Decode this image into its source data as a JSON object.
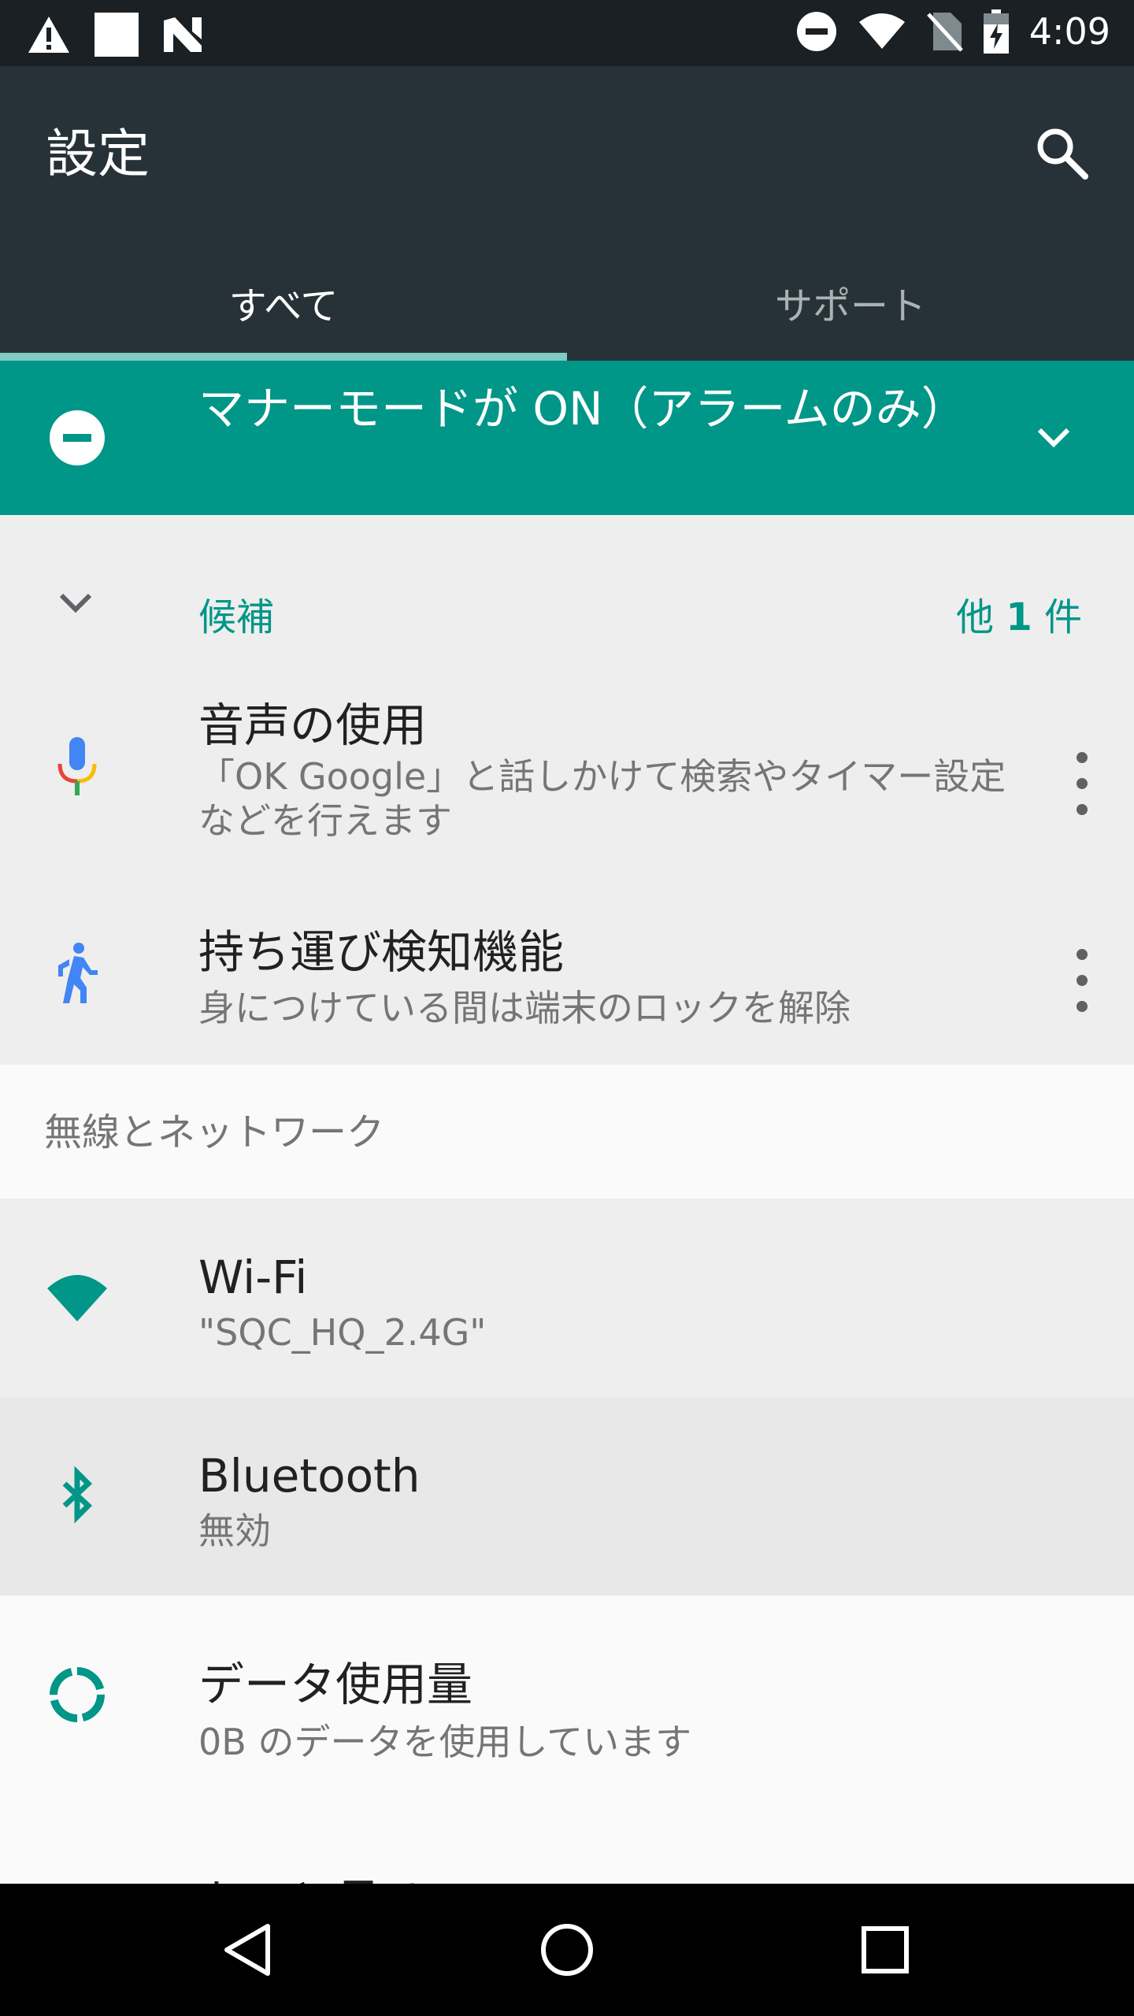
{
  "status_bar": {
    "time": "4:09",
    "left_icons": [
      "warning-icon",
      "square-icon",
      "n-logo-icon"
    ],
    "right_icons": [
      "do-not-disturb-icon",
      "wifi-icon",
      "no-sim-icon",
      "battery-charging-icon"
    ]
  },
  "app_bar": {
    "title": "設定",
    "search_icon": "search-icon",
    "tabs": [
      {
        "label": "すべて",
        "active": true
      },
      {
        "label": "サポート",
        "active": false
      }
    ],
    "indicator_color": "#80cbc4",
    "bg_color": "#263238"
  },
  "dnd_banner": {
    "text": "マナーモードが ON（アラームのみ）",
    "icon": "do-not-disturb-icon",
    "expand_icon": "chevron-down-icon",
    "bg_color": "#009688"
  },
  "suggestions": {
    "title": "候補",
    "more_prefix": "他",
    "more_count": "1",
    "more_suffix": "件",
    "items": [
      {
        "icon": "microphone-icon",
        "title": "音声の使用",
        "subtitle": "「OK Google」と話しかけて検索やタイマー設定などを行えます"
      },
      {
        "icon": "walking-person-icon",
        "title": "持ち運び検知機能",
        "subtitle": "身につけている間は端末のロックを解除"
      }
    ]
  },
  "wireless_section": {
    "title": "無線とネットワーク",
    "items": [
      {
        "icon": "wifi-icon",
        "title": "Wi-Fi",
        "subtitle": "\"SQC_HQ_2.4G\""
      },
      {
        "icon": "bluetooth-icon",
        "title": "Bluetooth",
        "subtitle": "無効"
      },
      {
        "icon": "data-usage-icon",
        "title": "データ使用量",
        "subtitle": "0B のデータを使用しています"
      }
    ],
    "partial_item": "もっと見る"
  },
  "nav_bar": {
    "buttons": [
      "back-icon",
      "home-icon",
      "recents-icon"
    ]
  },
  "accent_color": "#009688"
}
